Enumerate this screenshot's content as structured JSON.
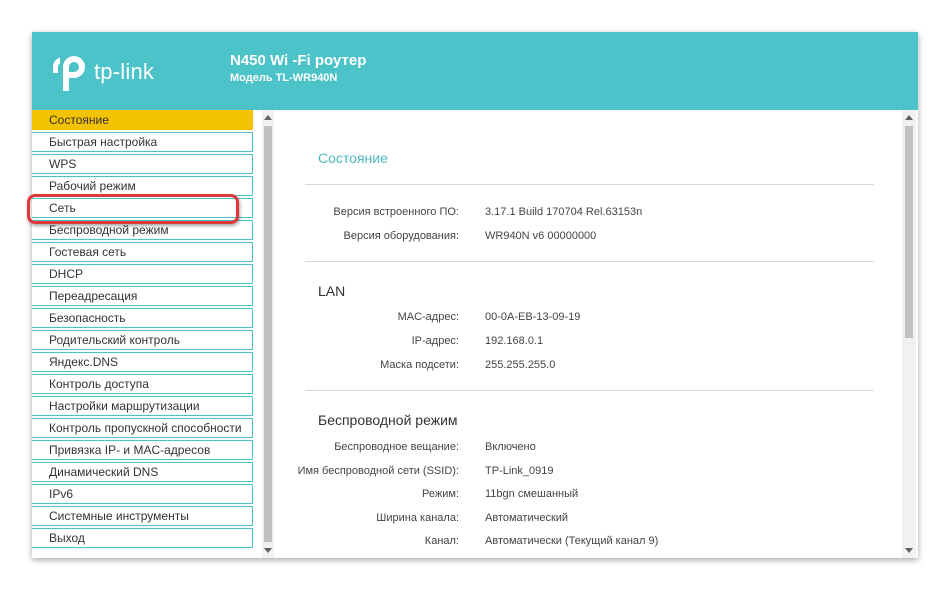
{
  "header": {
    "logo_text": "tp-link",
    "product_title": "N450 Wi -Fi роутер",
    "product_model": "Модель TL-WR940N",
    "brand_color": "#4bc3c9"
  },
  "sidebar": {
    "active_color": "#f3c300",
    "highlight_color": "#e0383a",
    "items": [
      {
        "label": "Состояние",
        "active": true
      },
      {
        "label": "Быстрая настройка"
      },
      {
        "label": "WPS"
      },
      {
        "label": "Рабочий режим"
      },
      {
        "label": "Сеть",
        "highlighted": true
      },
      {
        "label": "Беспроводной режим"
      },
      {
        "label": "Гостевая сеть"
      },
      {
        "label": "DHCP"
      },
      {
        "label": "Переадресация"
      },
      {
        "label": "Безопасность"
      },
      {
        "label": "Родительский контроль"
      },
      {
        "label": "Яндекс.DNS"
      },
      {
        "label": "Контроль доступа"
      },
      {
        "label": "Настройки маршрутизации"
      },
      {
        "label": "Контроль пропускной способности"
      },
      {
        "label": "Привязка IP- и MAC-адресов"
      },
      {
        "label": "Динамический DNS"
      },
      {
        "label": "IPv6"
      },
      {
        "label": "Системные инструменты"
      },
      {
        "label": "Выход"
      }
    ]
  },
  "main": {
    "status": {
      "title": "Состояние",
      "rows": [
        {
          "label": "Версия встроенного ПО:",
          "value": "3.17.1 Build 170704 Rel.63153n"
        },
        {
          "label": "Версия оборудования:",
          "value": "WR940N v6 00000000"
        }
      ]
    },
    "lan": {
      "title": "LAN",
      "rows": [
        {
          "label": "MAC-адрес:",
          "value": "00-0A-EB-13-09-19"
        },
        {
          "label": "IP-адрес:",
          "value": "192.168.0.1"
        },
        {
          "label": "Маска подсети:",
          "value": "255.255.255.0"
        }
      ]
    },
    "wireless": {
      "title": "Беспроводной режим",
      "rows": [
        {
          "label": "Беспроводное вещание:",
          "value": "Включено"
        },
        {
          "label": "Имя беспроводной сети (SSID):",
          "value": "TP-Link_0919"
        },
        {
          "label": "Режим:",
          "value": "11bgn смешанный"
        },
        {
          "label": "Ширина канала:",
          "value": "Автоматический"
        },
        {
          "label": "Канал:",
          "value": "Автоматически (Текущий канал 9)"
        }
      ]
    }
  }
}
